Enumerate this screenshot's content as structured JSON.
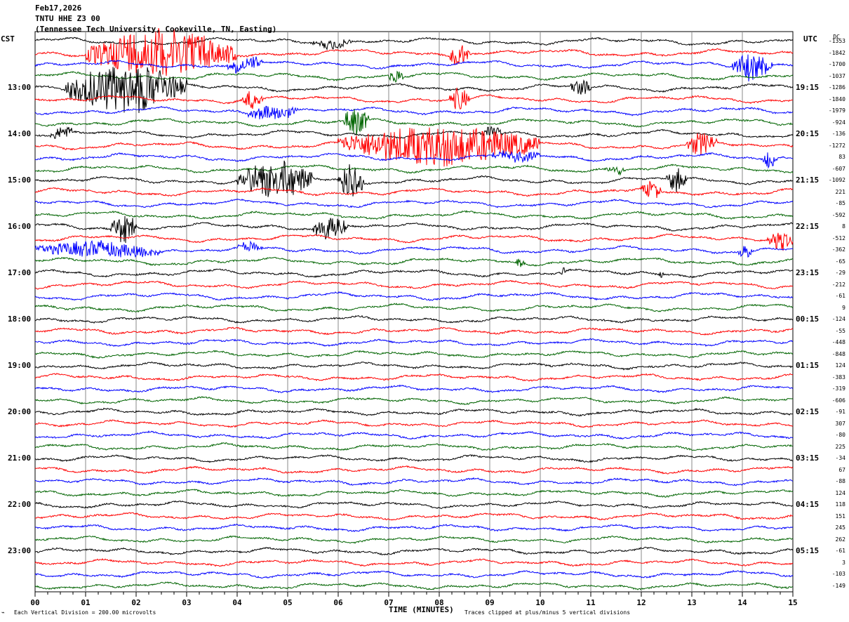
{
  "header": {
    "date": "Feb17,2026",
    "station": "TNTU HHE Z3 00",
    "location": "(Tennessee Tech University, Cookeville, TN, Easting)"
  },
  "left_axis_label": "CST",
  "right_axis_label": "UTC",
  "dc_label": "DC",
  "footer": {
    "scale": "Each Vertical Division =  200.00 microvolts",
    "xlabel": "TIME (MINUTES)",
    "clip_note": "Traces clipped at plus/minus 5 vertical divisions"
  },
  "chart_data": {
    "type": "line",
    "subtype": "helicorder",
    "xlabel": "TIME (MINUTES)",
    "xlim": [
      0,
      15
    ],
    "x_ticks": [
      "00",
      "01",
      "02",
      "03",
      "04",
      "05",
      "06",
      "07",
      "08",
      "09",
      "10",
      "11",
      "12",
      "13",
      "14",
      "15"
    ],
    "trace_colors": [
      "#000000",
      "#ff0000",
      "#0000ff",
      "#006400"
    ],
    "cst_labels": [
      "13:00",
      "14:00",
      "15:00",
      "16:00",
      "17:00",
      "18:00",
      "19:00",
      "20:00",
      "21:00",
      "22:00",
      "23:00"
    ],
    "utc_labels": [
      "19:15",
      "20:15",
      "21:15",
      "22:15",
      "23:15",
      "00:15",
      "01:15",
      "02:15",
      "03:15",
      "04:15",
      "05:15"
    ],
    "trace_count": 48,
    "trace_interval_minutes": 15,
    "dc_offsets": [
      "-1353",
      "-1842",
      "-1700",
      "-1037",
      "-1286",
      "-1840",
      "-1979",
      "-924",
      "-136",
      "-1272",
      "83",
      "-607",
      "-1092",
      "221",
      "-85",
      "-592",
      "8",
      "-512",
      "-362",
      "-65",
      "-29",
      "-212",
      "-61",
      "9",
      "-124",
      "-55",
      "-448",
      "-848",
      "124",
      "-383",
      "-319",
      "-606",
      "-91",
      "307",
      "-80",
      "225",
      "-34",
      "67",
      "-88",
      "124",
      "118",
      "151",
      "245",
      "262",
      "-61",
      "3",
      "-103",
      "-149"
    ],
    "events": [
      {
        "trace": 0,
        "start_min": 5.5,
        "end_min": 6.3,
        "amp": 0.6
      },
      {
        "trace": 1,
        "start_min": 1.0,
        "end_min": 4.0,
        "amp": 3
      },
      {
        "trace": 1,
        "start_min": 8.2,
        "end_min": 8.6,
        "amp": 1.5
      },
      {
        "trace": 2,
        "start_min": 3.8,
        "end_min": 4.5,
        "amp": 1
      },
      {
        "trace": 2,
        "start_min": 13.8,
        "end_min": 14.6,
        "amp": 1.8
      },
      {
        "trace": 3,
        "start_min": 7.0,
        "end_min": 7.3,
        "amp": 1
      },
      {
        "trace": 4,
        "start_min": 0.6,
        "end_min": 3.0,
        "amp": 3
      },
      {
        "trace": 4,
        "start_min": 10.6,
        "end_min": 11.0,
        "amp": 1.2
      },
      {
        "trace": 5,
        "start_min": 4.1,
        "end_min": 4.5,
        "amp": 1.2
      },
      {
        "trace": 5,
        "start_min": 8.2,
        "end_min": 8.6,
        "amp": 1.5
      },
      {
        "trace": 6,
        "start_min": 4.2,
        "end_min": 5.2,
        "amp": 1
      },
      {
        "trace": 7,
        "start_min": 6.1,
        "end_min": 6.6,
        "amp": 1.8
      },
      {
        "trace": 8,
        "start_min": 0.3,
        "end_min": 0.8,
        "amp": 0.8
      },
      {
        "trace": 8,
        "start_min": 8.8,
        "end_min": 9.3,
        "amp": 0.6
      },
      {
        "trace": 9,
        "start_min": 6.0,
        "end_min": 10.0,
        "amp": 2.5
      },
      {
        "trace": 9,
        "start_min": 12.9,
        "end_min": 13.5,
        "amp": 1.5
      },
      {
        "trace": 10,
        "start_min": 9.0,
        "end_min": 10.0,
        "amp": 0.8
      },
      {
        "trace": 10,
        "start_min": 14.4,
        "end_min": 14.7,
        "amp": 1.2
      },
      {
        "trace": 11,
        "start_min": 11.3,
        "end_min": 11.7,
        "amp": 0.6
      },
      {
        "trace": 12,
        "start_min": 4.0,
        "end_min": 5.5,
        "amp": 2.5
      },
      {
        "trace": 12,
        "start_min": 6.0,
        "end_min": 6.5,
        "amp": 2.5
      },
      {
        "trace": 12,
        "start_min": 12.5,
        "end_min": 12.9,
        "amp": 1.5
      },
      {
        "trace": 13,
        "start_min": 12.0,
        "end_min": 12.4,
        "amp": 1.2
      },
      {
        "trace": 16,
        "start_min": 1.5,
        "end_min": 2.0,
        "amp": 2
      },
      {
        "trace": 16,
        "start_min": 5.5,
        "end_min": 6.2,
        "amp": 1.5
      },
      {
        "trace": 17,
        "start_min": 14.5,
        "end_min": 15.0,
        "amp": 1.2
      },
      {
        "trace": 18,
        "start_min": 0.0,
        "end_min": 2.5,
        "amp": 1
      },
      {
        "trace": 18,
        "start_min": 4.0,
        "end_min": 4.5,
        "amp": 0.6
      },
      {
        "trace": 18,
        "start_min": 13.9,
        "end_min": 14.2,
        "amp": 0.8
      },
      {
        "trace": 19,
        "start_min": 9.5,
        "end_min": 9.7,
        "amp": 0.6
      },
      {
        "trace": 20,
        "start_min": 10.4,
        "end_min": 10.5,
        "amp": 0.5
      },
      {
        "trace": 20,
        "start_min": 12.35,
        "end_min": 12.45,
        "amp": 0.5
      }
    ]
  }
}
